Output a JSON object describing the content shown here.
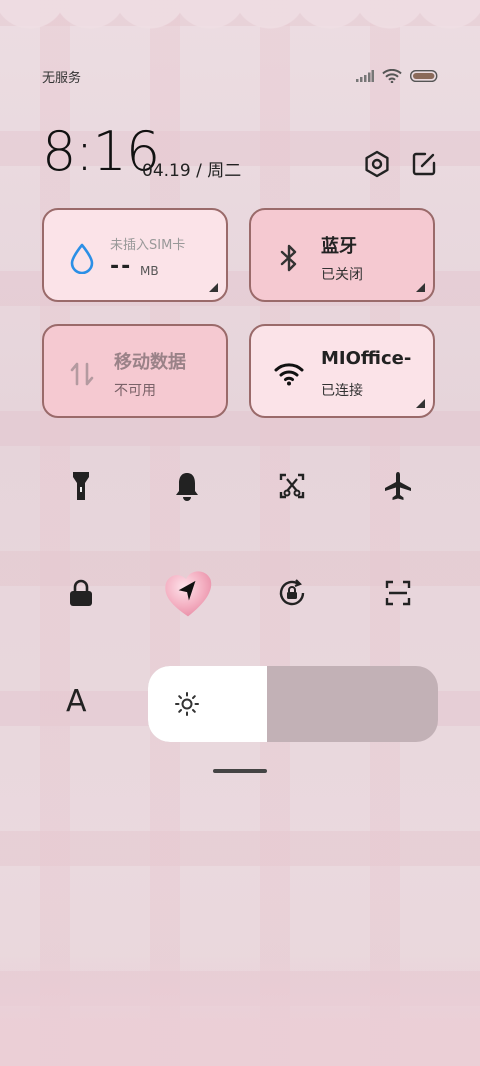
{
  "status_bar": {
    "carrier": "无服务",
    "icons": [
      "signal-icon",
      "wifi-icon",
      "battery-icon"
    ]
  },
  "header": {
    "time": "8:16",
    "date": "04.19 / 周二",
    "icons": [
      "settings-icon",
      "edit-icon"
    ]
  },
  "tiles": [
    {
      "id": "data-usage",
      "icon": "water-drop-icon",
      "title": "未插入SIM卡",
      "value": "--",
      "unit": "MB",
      "state": "light"
    },
    {
      "id": "bluetooth",
      "icon": "bluetooth-icon",
      "title": "蓝牙",
      "subtitle": "已关闭",
      "state": "pink"
    },
    {
      "id": "mobile-data",
      "icon": "mobile-data-icon",
      "title": "移动数据",
      "subtitle": "不可用",
      "state": "pink-disabled"
    },
    {
      "id": "wifi",
      "icon": "wifi-icon",
      "title": "MIOffice-",
      "subtitle": "已连接",
      "state": "light"
    }
  ],
  "toggles_row1": [
    "flashlight-icon",
    "bell-icon",
    "screenshot-icon",
    "airplane-icon"
  ],
  "toggles_row2": [
    "lock-icon",
    "location-icon",
    "rotation-lock-icon",
    "scan-icon"
  ],
  "brightness": {
    "auto_label": "A",
    "level": 0.41
  },
  "colors": {
    "tile_light": "#fbe3e8",
    "tile_pink": "#f5c9d1",
    "tile_border": "#9a6a6a",
    "wifi_blue": "#2b8fe6"
  }
}
